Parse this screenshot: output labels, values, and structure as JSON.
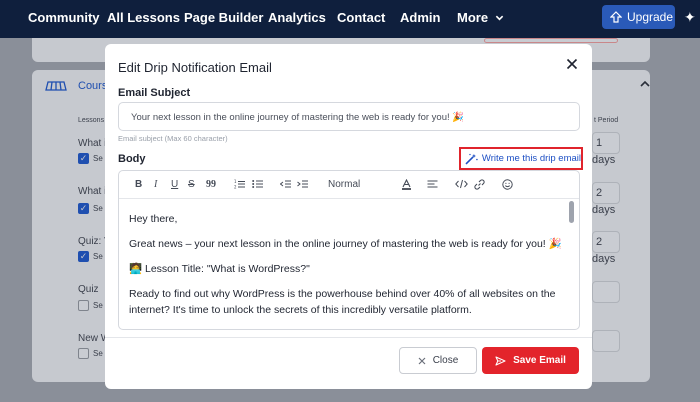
{
  "nav": {
    "items": [
      "Community",
      "All Lessons",
      "Page Builder",
      "Analytics",
      "Contact",
      "Admin",
      "More"
    ],
    "upgrade_label": "Upgrade"
  },
  "background": {
    "course_title": "Cours",
    "col_lessons": "Lessons",
    "col_period": "t Period",
    "rows": [
      {
        "title": "What i",
        "check_label": "Se",
        "checked": true,
        "period": "1",
        "unit": "days"
      },
      {
        "title": "What i",
        "check_label": "Se",
        "checked": true,
        "period": "2",
        "unit": "days"
      },
      {
        "title": "Quiz: V",
        "check_label": "Se",
        "checked": true,
        "period": "2",
        "unit": "days"
      },
      {
        "title": "Quiz",
        "check_label": "Se",
        "checked": false,
        "period": "",
        "unit": ""
      },
      {
        "title": "New W",
        "check_label": "Se",
        "checked": false,
        "period": "",
        "unit": ""
      }
    ]
  },
  "modal": {
    "title": "Edit Drip Notification Email",
    "subject_label": "Email Subject",
    "subject_value": "Your next lesson in the online journey of mastering the web is ready for you! 🎉",
    "subject_helper": "Email subject (Max 60 character)",
    "body_label": "Body",
    "ai_button": "Write me this drip email",
    "toolbar": {
      "format_label": "Normal",
      "tools": [
        "bold",
        "italic",
        "underline",
        "strikethrough",
        "blockquote",
        "ordered-list",
        "bullet-list",
        "outdent",
        "indent",
        "text-color",
        "align",
        "code",
        "link",
        "emoji"
      ]
    },
    "body_paragraphs": [
      "Hey there,",
      "Great news – your next lesson in the online journey of mastering the web is ready for you! 🎉",
      "🧑‍💻 Lesson Title: \"What is WordPress?\"",
      "Ready to find out why WordPress is the powerhouse behind over 40% of all websites on the internet? It's time to unlock the secrets of this incredibly versatile platform."
    ],
    "close_button": "Close",
    "save_button": "Save Email"
  },
  "colors": {
    "nav_bg": "#0f1f3d",
    "accent_blue": "#1d4fc4",
    "save_red": "#e3242b",
    "highlight_red": "#e0242c"
  }
}
